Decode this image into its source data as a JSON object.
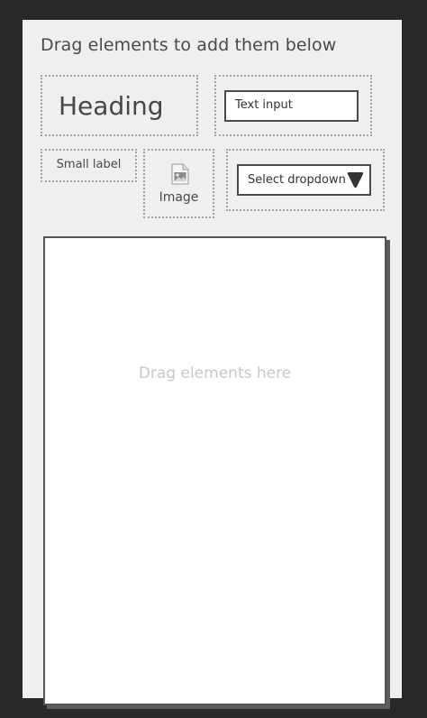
{
  "instructions": "Drag elements to add them below",
  "palette": {
    "heading": {
      "label": "Heading"
    },
    "text_input": {
      "placeholder": "Text input"
    },
    "small_label": {
      "label": "Small label"
    },
    "image": {
      "label": "Image",
      "icon": "image-file-icon"
    },
    "select": {
      "label": "Select dropdown",
      "icon": "triangle-down-icon"
    }
  },
  "dropzone": {
    "placeholder": "Drag elements here"
  },
  "colors": {
    "background": "#282828",
    "panel": "#efefef",
    "text": "#4a4a4a",
    "dotted_border": "#a6a6a6",
    "dropzone_placeholder": "#c8c8c8"
  }
}
